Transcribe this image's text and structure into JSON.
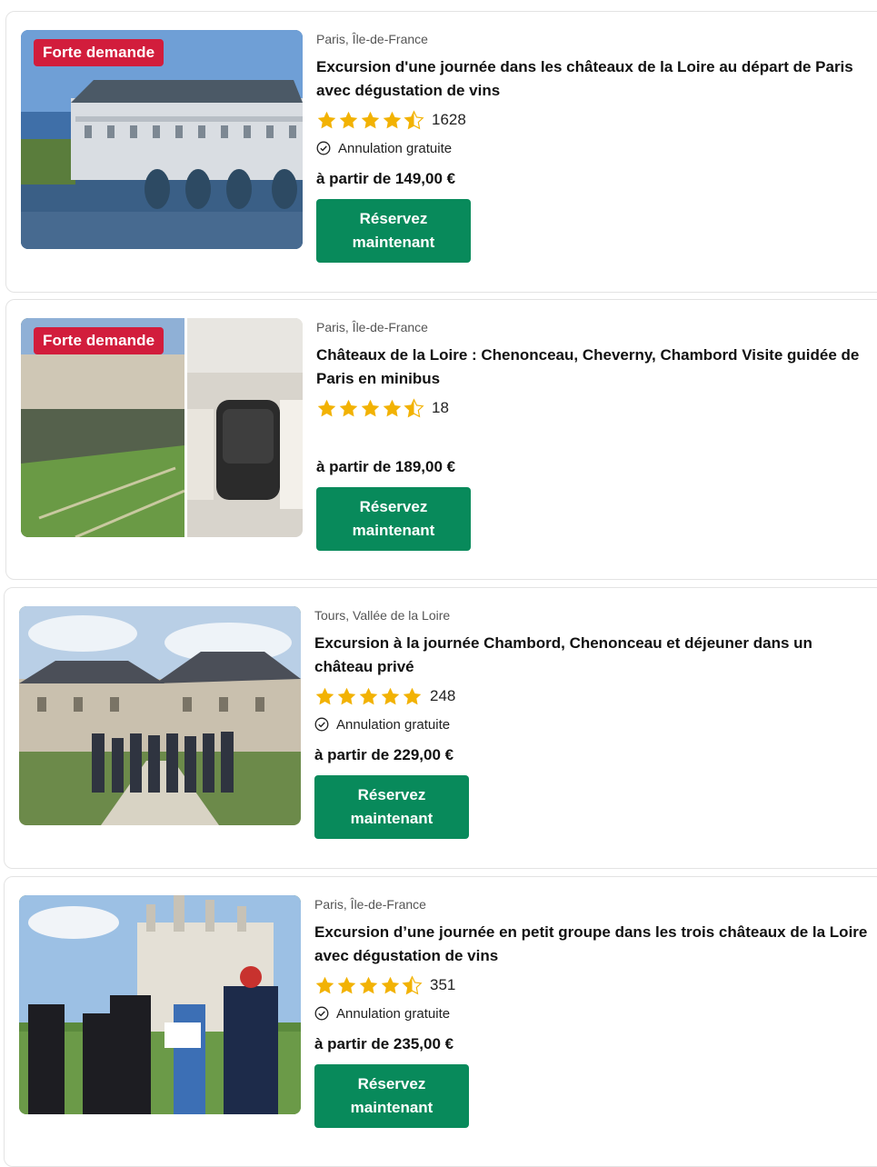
{
  "listings": [
    {
      "badge": "Forte demande",
      "location": "Paris, Île-de-France",
      "title": "Excursion d'une journée dans les châteaux de la Loire au départ de Paris avec dégustation de vins",
      "rating_stars": 4.5,
      "review_count": "1628",
      "free_cancellation": "Annulation gratuite",
      "price": "à partir de 149,00 €",
      "button_label": "Réservez maintenant"
    },
    {
      "badge": "Forte demande",
      "location": "Paris, Île-de-France",
      "title": "Châteaux de la Loire : Chenonceau, Cheverny, Chambord Visite guidée de Paris en minibus",
      "rating_stars": 4.5,
      "review_count": "18",
      "free_cancellation": "",
      "price": "à partir de 189,00 €",
      "button_label": "Réservez maintenant"
    },
    {
      "badge": "",
      "location": "Tours, Vallée de la Loire",
      "title": "Excursion à la journée Chambord, Chenonceau et déjeuner dans un château privé",
      "rating_stars": 5,
      "review_count": "248",
      "free_cancellation": "Annulation gratuite",
      "price": "à partir de 229,00 €",
      "button_label": "Réservez maintenant"
    },
    {
      "badge": "",
      "location": "Paris, Île-de-France",
      "title": "Excursion d’une journée en petit groupe dans les trois châteaux de la Loire avec dégustation de vins",
      "rating_stars": 4.5,
      "review_count": "351",
      "free_cancellation": "Annulation gratuite",
      "price": "à partir de 235,00 €",
      "button_label": "Réservez maintenant"
    }
  ],
  "icons": {
    "star": "star-icon",
    "half_star": "half-star-icon",
    "check": "check-circle-icon"
  },
  "colors": {
    "badge": "#d21d3c",
    "button": "#088a5b",
    "star": "#f2b203"
  }
}
